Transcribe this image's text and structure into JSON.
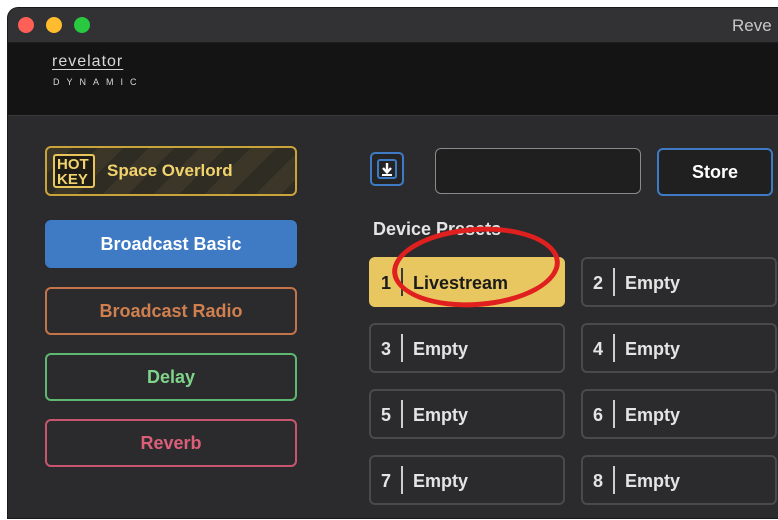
{
  "window": {
    "title": "Reve"
  },
  "brand": {
    "name": "revelator",
    "subtitle": "DYNAMIC"
  },
  "hotkey": {
    "tag": "HOT KEY",
    "preset_name": "Space Overlord"
  },
  "presets": {
    "broadcast_basic": "Broadcast Basic",
    "broadcast_radio": "Broadcast Radio",
    "delay": "Delay",
    "reverb": "Reverb"
  },
  "store": {
    "input_value": "",
    "button_label": "Store"
  },
  "device_presets": {
    "title": "Device Presets",
    "slots": [
      {
        "number": "1",
        "label": "Livestream",
        "active": true
      },
      {
        "number": "2",
        "label": "Empty"
      },
      {
        "number": "3",
        "label": "Empty"
      },
      {
        "number": "4",
        "label": "Empty"
      },
      {
        "number": "5",
        "label": "Empty"
      },
      {
        "number": "6",
        "label": "Empty"
      },
      {
        "number": "7",
        "label": "Empty"
      },
      {
        "number": "8",
        "label": "Empty"
      }
    ]
  },
  "icons": {
    "download": "download-icon"
  },
  "colors": {
    "accent_blue": "#3f7ac4",
    "hotkey_gold": "#e9c760",
    "radio_orange": "#c4744a",
    "delay_green": "#5fb870",
    "reverb_pink": "#c8556e",
    "annotation_red": "#e0201f"
  }
}
